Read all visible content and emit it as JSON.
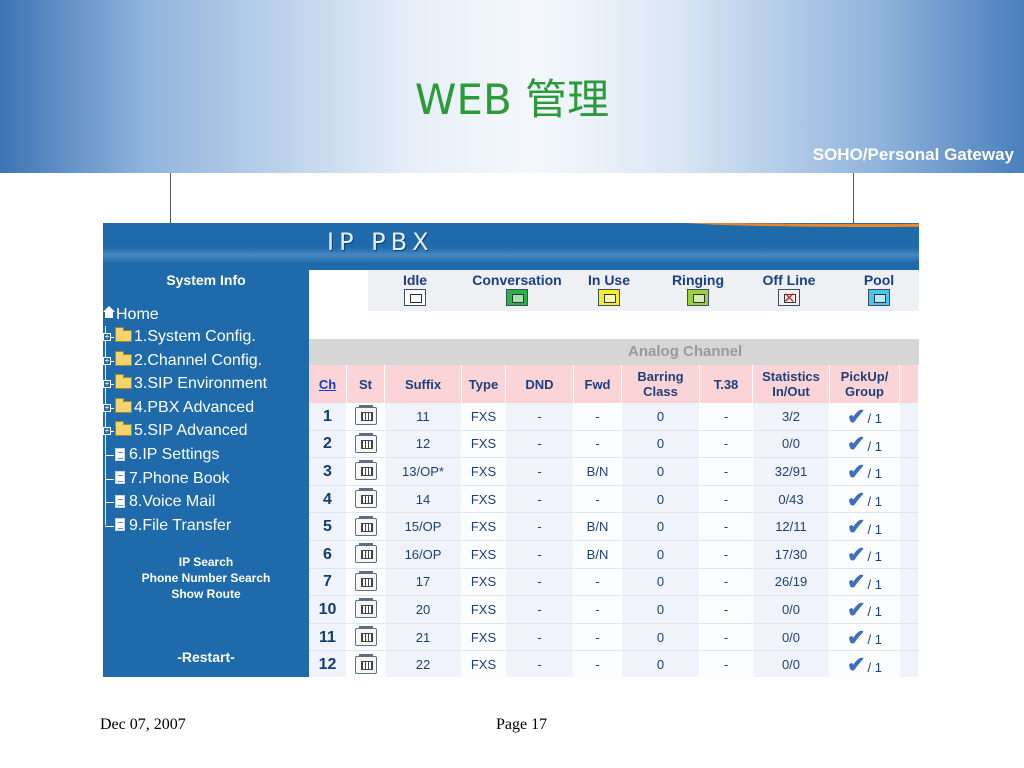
{
  "slide": {
    "title": "WEB 管理",
    "subtitle": "SOHO/Personal Gateway",
    "footer_date": "Dec 07, 2007",
    "footer_page": "Page 17"
  },
  "app": {
    "header_title": "IP PBX"
  },
  "sidebar": {
    "system_info": "System Info",
    "home": "Home",
    "items": [
      {
        "label": "1.System Config.",
        "icon": "folder-icon",
        "expandable": true
      },
      {
        "label": "2.Channel Config.",
        "icon": "folder-icon",
        "expandable": true
      },
      {
        "label": "3.SIP Environment",
        "icon": "folder-icon",
        "expandable": true
      },
      {
        "label": "4.PBX Advanced",
        "icon": "folder-icon",
        "expandable": true
      },
      {
        "label": "5.SIP Advanced",
        "icon": "folder-icon",
        "expandable": true
      },
      {
        "label": "6.IP Settings",
        "icon": "page-icon",
        "expandable": false
      },
      {
        "label": "7.Phone Book",
        "icon": "page-icon",
        "expandable": false
      },
      {
        "label": "8.Voice Mail",
        "icon": "page-icon",
        "expandable": false
      },
      {
        "label": "9.File Transfer",
        "icon": "page-icon",
        "expandable": false
      }
    ],
    "links": [
      "IP Search",
      "Phone Number Search",
      "Show Route"
    ],
    "restart": "-Restart-"
  },
  "legend": [
    {
      "label": "Idle",
      "color": "#ffffff",
      "icon": "phone-idle-icon"
    },
    {
      "label": "Conversation",
      "color": "#27b24a",
      "icon": "phone-conversation-icon"
    },
    {
      "label": "In Use",
      "color": "#f4ec2c",
      "icon": "phone-in-use-icon"
    },
    {
      "label": "Ringing",
      "color": "#9ad13a",
      "icon": "phone-ringing-icon"
    },
    {
      "label": "Off Line",
      "color": "#f0f0f0",
      "icon": "phone-offline-icon"
    },
    {
      "label": "Pool",
      "color": "#48c6ee",
      "icon": "phone-pool-icon"
    }
  ],
  "table": {
    "group_title": "Analog Channel",
    "headers": [
      "Ch",
      "St",
      "Suffix",
      "Type",
      "DND",
      "Fwd",
      "Barring Class",
      "T.38",
      "Statistics In/Out",
      "PickUp/ Group"
    ],
    "rows": [
      {
        "ch": "1",
        "suffix": "11",
        "type": "FXS",
        "dnd": "-",
        "fwd": "-",
        "barring": "0",
        "t38": "-",
        "stats": "3/2",
        "group": "/ 1"
      },
      {
        "ch": "2",
        "suffix": "12",
        "type": "FXS",
        "dnd": "-",
        "fwd": "-",
        "barring": "0",
        "t38": "-",
        "stats": "0/0",
        "group": "/ 1"
      },
      {
        "ch": "3",
        "suffix": "13/OP*",
        "type": "FXS",
        "dnd": "-",
        "fwd": "B/N",
        "barring": "0",
        "t38": "-",
        "stats": "32/91",
        "group": "/ 1"
      },
      {
        "ch": "4",
        "suffix": "14",
        "type": "FXS",
        "dnd": "-",
        "fwd": "-",
        "barring": "0",
        "t38": "-",
        "stats": "0/43",
        "group": "/ 1"
      },
      {
        "ch": "5",
        "suffix": "15/OP",
        "type": "FXS",
        "dnd": "-",
        "fwd": "B/N",
        "barring": "0",
        "t38": "-",
        "stats": "12/11",
        "group": "/ 1"
      },
      {
        "ch": "6",
        "suffix": "16/OP",
        "type": "FXS",
        "dnd": "-",
        "fwd": "B/N",
        "barring": "0",
        "t38": "-",
        "stats": "17/30",
        "group": "/ 1"
      },
      {
        "ch": "7",
        "suffix": "17",
        "type": "FXS",
        "dnd": "-",
        "fwd": "-",
        "barring": "0",
        "t38": "-",
        "stats": "26/19",
        "group": "/ 1"
      },
      {
        "ch": "10",
        "suffix": "20",
        "type": "FXS",
        "dnd": "-",
        "fwd": "-",
        "barring": "0",
        "t38": "-",
        "stats": "0/0",
        "group": "/ 1"
      },
      {
        "ch": "11",
        "suffix": "21",
        "type": "FXS",
        "dnd": "-",
        "fwd": "-",
        "barring": "0",
        "t38": "-",
        "stats": "0/0",
        "group": "/ 1"
      },
      {
        "ch": "12",
        "suffix": "22",
        "type": "FXS",
        "dnd": "-",
        "fwd": "-",
        "barring": "0",
        "t38": "-",
        "stats": "0/0",
        "group": "/ 1"
      }
    ]
  }
}
